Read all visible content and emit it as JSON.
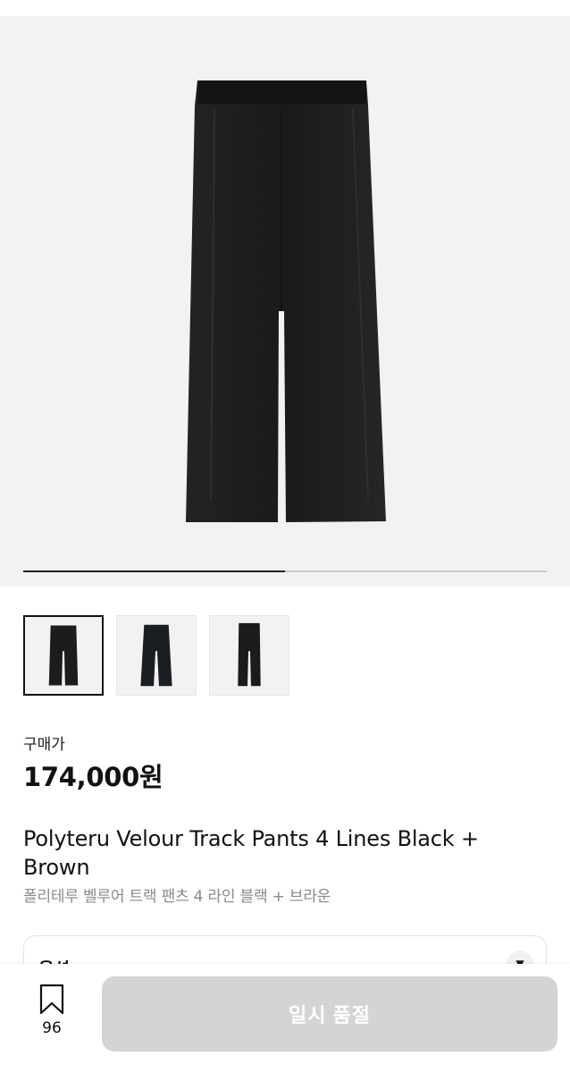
{
  "product": {
    "price_label": "구매가",
    "price": "174,000원",
    "name_en": "Polyteru Velour Track Pants 4 Lines Black + Brown",
    "name_ko": "폴리테루 벨루어 트랙 팬츠 4 라인 블랙 + 브라운",
    "image_progress": 0.5,
    "thumbnail_count": 3,
    "active_thumbnail": 1
  },
  "options": {
    "label": "옵션",
    "chevron_icon": "chevron-down-icon"
  },
  "bottom_bar": {
    "bookmark_icon": "bookmark-icon",
    "bookmark_count": "96",
    "action_label": "일시 품절"
  },
  "colors": {
    "hero_background": "#f2f2f2",
    "disabled_button": "#d4d4d4",
    "subtitle_gray": "#8a8a8a",
    "pants": "#1b1b1b"
  }
}
